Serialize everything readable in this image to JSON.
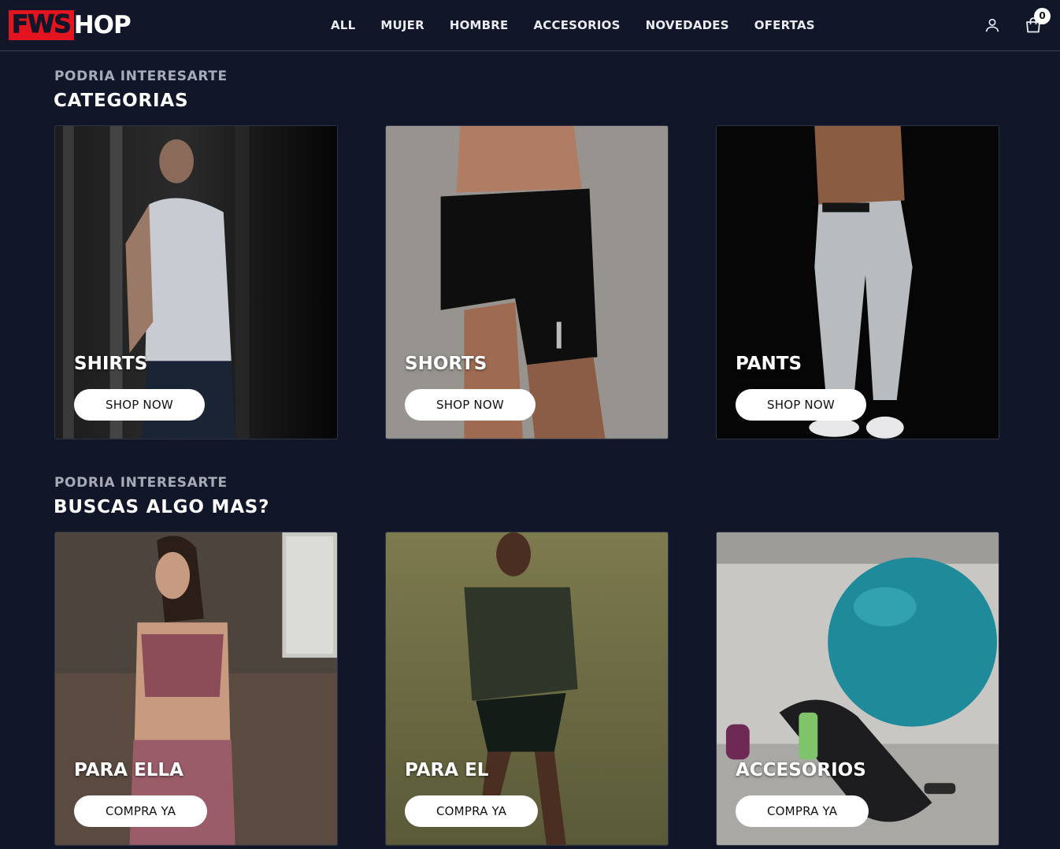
{
  "brand": {
    "part1": "FWS",
    "part2": "HOP"
  },
  "nav": [
    "ALL",
    "MUJER",
    "HOMBRE",
    "ACCESORIOS",
    "NOVEDADES",
    "OFERTAS"
  ],
  "cart": {
    "count": "0"
  },
  "icons": {
    "user": "user-icon",
    "cart": "shopping-bag-icon"
  },
  "colors": {
    "background": "#111729",
    "brand_red": "#e1141f",
    "button": "#ffffff"
  },
  "sections": [
    {
      "eyebrow": "PODRIA INTERESARTE",
      "title": "CATEGORIAS",
      "cards": [
        {
          "title": "SHIRTS",
          "button": "SHOP NOW"
        },
        {
          "title": "SHORTS",
          "button": "SHOP NOW"
        },
        {
          "title": "PANTS",
          "button": "SHOP NOW"
        }
      ]
    },
    {
      "eyebrow": "PODRIA INTERESARTE",
      "title": "BUSCAS ALGO MAS?",
      "cards": [
        {
          "title": "PARA ELLA",
          "button": "COMPRA YA"
        },
        {
          "title": "PARA EL",
          "button": "COMPRA YA"
        },
        {
          "title": "ACCESORIOS",
          "button": "COMPRA YA"
        }
      ]
    }
  ]
}
